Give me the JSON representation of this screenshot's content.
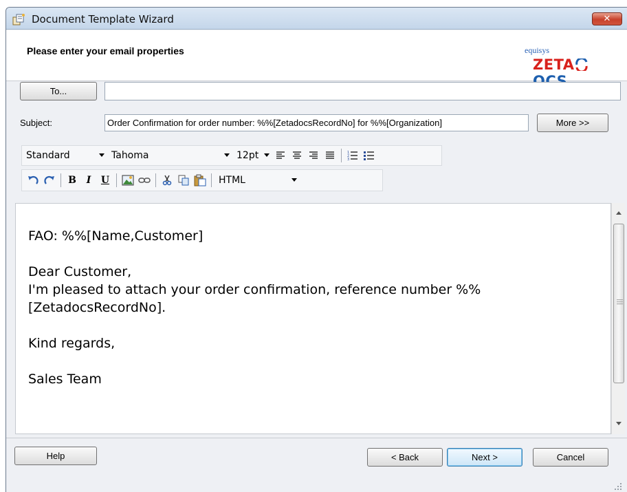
{
  "window": {
    "title": "Document Template Wizard",
    "close_label": "✕"
  },
  "header": {
    "title": "Please enter your email properties",
    "logo_small": "equisys",
    "logo_main_a": "ZETA",
    "logo_main_b": "OCS"
  },
  "email": {
    "to_label": "To...",
    "to_value": "",
    "subject_label": "Subject:",
    "subject_value": "Order Confirmation for order number: %%[ZetadocsRecordNo] for %%[Organization]",
    "more_label": "More >>"
  },
  "toolbar": {
    "style_value": "Standard",
    "font_value": "Tahoma",
    "size_value": "12pt",
    "format_value": "HTML"
  },
  "body": {
    "line1": "FAO: %%[Name,Customer]",
    "line2": "Dear Customer,",
    "line3": "I'm pleased to attach your order confirmation, reference number %%",
    "line4": "[ZetadocsRecordNo].",
    "line5": "Kind regards,",
    "line6": "Sales Team"
  },
  "footer": {
    "help_label": "Help",
    "back_label": "< Back",
    "next_label": "Next >",
    "cancel_label": "Cancel"
  },
  "colors": {
    "logo_red": "#d8211c",
    "logo_blue": "#1d5fae",
    "close_red": "#c8422c"
  }
}
